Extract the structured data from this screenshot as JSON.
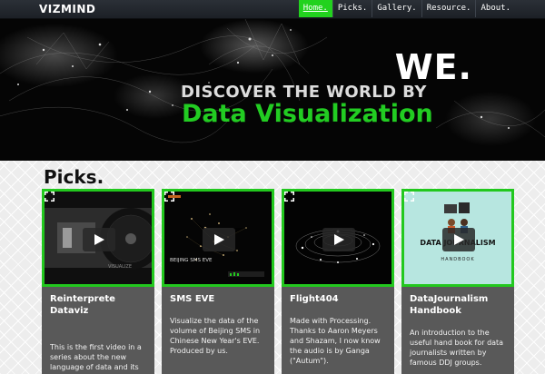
{
  "header": {
    "logo": "VIZMIND",
    "nav": [
      {
        "label": "Home.",
        "active": true
      },
      {
        "label": "Picks.",
        "active": false
      },
      {
        "label": "Gallery.",
        "active": false
      },
      {
        "label": "Resource.",
        "active": false
      },
      {
        "label": "About.",
        "active": false
      }
    ]
  },
  "hero": {
    "headline": "WE.",
    "subline": "DISCOVER THE WORLD BY",
    "highlight": "Data Visualization",
    "accent_color": "#22cc22"
  },
  "picks": {
    "title": "Picks.",
    "cards": [
      {
        "title": "Reinterprete Dataviz",
        "description": "This is the first video in a series about the new language of data and its impact on culture.",
        "thumb_text": "VISUALIZE"
      },
      {
        "title": "SMS EVE",
        "description": "Visualize the data of the volume of Beijing SMS in Chinese New Year's EVE. Produced by us.",
        "thumb_text": "BEIJING SMS EVE"
      },
      {
        "title": "Flight404",
        "description": "Made with Processing. Thanks to Aaron Meyers and Shazam, I now know the audio is by Ganga (\"Autum\").",
        "thumb_text": ""
      },
      {
        "title": "DataJournalism Handbook",
        "description": "An introduction to the useful hand book for data journalists written by famous DDJ groups.",
        "thumb_text": "DATA JOURNALISM",
        "thumb_subtext": "HANDBOOK"
      }
    ]
  }
}
